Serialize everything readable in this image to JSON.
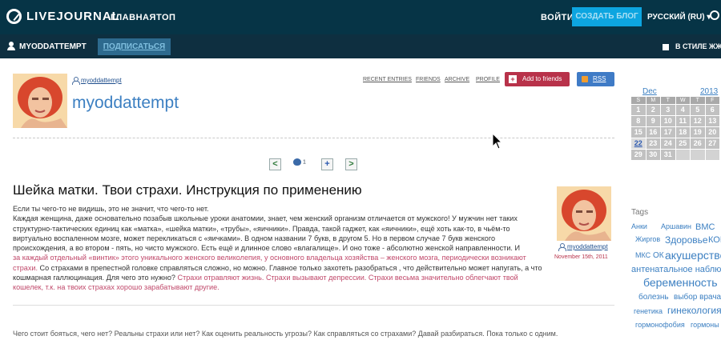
{
  "topbar": {
    "logo_text": "LIVEJOURNAL",
    "nav": [
      "ГЛАВНАЯ",
      "ТОП"
    ],
    "login": "ВОЙТИ",
    "signup": "СОЗДАТЬ БЛОГ",
    "language": "РУССКИЙ (RU) ▾"
  },
  "subbar": {
    "username": "MYODDATTEMPT",
    "subscribe": "ПОДПИСАТЬСЯ",
    "style_label": "В СТИЛЕ ЖЖ"
  },
  "journal": {
    "small_username": "myoddattempt",
    "title": "myoddattempt",
    "nav": [
      "RECENT ENTRIES",
      "FRIENDS",
      "ARCHIVE",
      "PROFILE"
    ],
    "add_friends": "Add to friends",
    "rss": "RSS"
  },
  "entry_nav": {
    "prev": "<",
    "likes": "1",
    "add": "+",
    "next": ">"
  },
  "entry": {
    "title": "Шейка матки. Твои страхи. Инструкция по применению",
    "p1": "Если ты чего-то не видишь, это не значит, что чего-то нет.",
    "p2": "Каждая женщина, даже основательно позабыв школьные уроки анатомии, знает, чем женский организм отличается от мужского! У мужчин нет таких структурно-тактических единиц как «матка», «шейка матки», «трубы», «яичники». Правда, такой гаджет, как «яичники», ещё хоть как-то, в чьём-то виртуально воспаленном мозге, может перекликаться с «яичками». В одном названии 7 букв, в другом 5. Но в первом случае 7 букв женского происхождения, а во втором - пять, но чисто мужского. Есть ещё и длинное слово «влагалище». И оно тоже - абсолютно женской направленности. И",
    "p3_link": "за каждый отдельный «винтик» этого уникального женского великолепия, у основного владельца хозяйства – женского мозга, периодически возникают страхи.",
    "p3_text": " Со страхами в препестной головке справляться сложно, но можно. Главное только захотеть разобраться , что действительно может напугать, а что кошмарная галлюцинация. Для чего это нужно?",
    "p3_link2": " Страхи отравляют жизнь. Страхи вызывают депрессии. Страхи весьма значительно облегчают твой кошелек, т.к. на твоих страхах хорошо зарабатывают другие.",
    "author": "myoddattempt",
    "date": "November 15th, 2011",
    "more": "Чего стоит бояться, чего нет? Реальны страхи или нет? Как оценить реальность угрозы? Как справляться со страхами? Давай разбираться. Пока только с одним."
  },
  "calendar": {
    "month": "Dec",
    "year": "2013",
    "headers": [
      "S",
      "M",
      "T",
      "W",
      "T",
      "F"
    ],
    "cells": [
      "1",
      "2",
      "3",
      "4",
      "5",
      "6",
      "8",
      "9",
      "10",
      "11",
      "12",
      "13",
      "15",
      "16",
      "17",
      "18",
      "19",
      "20",
      "22",
      "23",
      "24",
      "25",
      "26",
      "27",
      "29",
      "30",
      "31",
      "",
      "",
      ""
    ],
    "today": "22"
  },
  "tags": {
    "title": "Tags",
    "items": [
      "Анки",
      "Аршавин",
      "ВМС",
      "Жиргов",
      "Здоровье",
      "КОКИ",
      "МКС",
      "ОК",
      "акушерство",
      "антенатальное наблюдение",
      "беременность",
      "болезнь",
      "выбор врача",
      "генетика",
      "гинекология",
      "гормонофобия",
      "гормоны"
    ]
  },
  "colors": {
    "topbar": "#063446",
    "accent": "#0da5e0",
    "link": "#3d80c2",
    "add_friends": "#b8324a"
  }
}
